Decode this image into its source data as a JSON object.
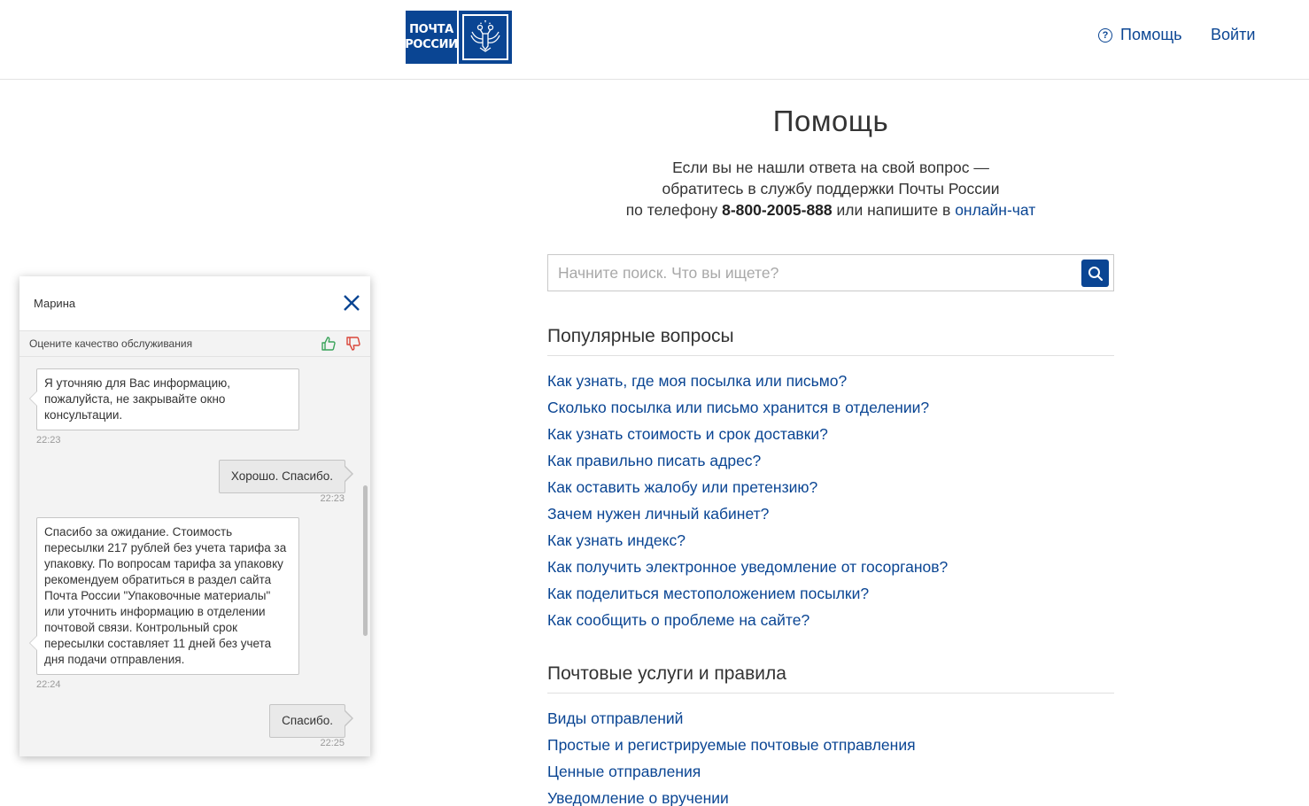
{
  "header": {
    "logo_line1": "ПОЧТА",
    "logo_line2": "РОССИИ",
    "help_label": "Помощь",
    "login_label": "Войти",
    "brand_color": "#0a4593"
  },
  "main": {
    "title": "Помощь",
    "intro_line1": "Если вы не нашли ответа на свой вопрос —",
    "intro_line2": "обратитесь в службу поддержки Почты России",
    "intro_line3_prefix": "по телефону ",
    "phone": "8-800-2005-888",
    "intro_line3_middle": " или напишите в ",
    "chat_link": "онлайн-чат",
    "search_placeholder": "Начните поиск. Что вы ищете?"
  },
  "sections": [
    {
      "title": "Популярные вопросы",
      "links": [
        "Как узнать, где моя посылка или письмо?",
        "Сколько посылка или письмо хранится в отделении?",
        "Как узнать стоимость и срок доставки?",
        "Как правильно писать адрес?",
        "Как оставить жалобу или претензию?",
        "Зачем нужен личный кабинет?",
        "Как узнать индекс?",
        "Как получить электронное уведомление от госорганов?",
        "Как поделиться местоположением посылки?",
        "Как сообщить о проблеме на сайте?"
      ]
    },
    {
      "title": "Почтовые услуги и правила",
      "links": [
        "Виды отправлений",
        "Простые и регистрируемые почтовые отправления",
        "Ценные отправления",
        "Уведомление о вручении"
      ]
    }
  ],
  "chat": {
    "agent_name": "Марина",
    "rate_label": "Оцените качество обслуживания",
    "messages": [
      {
        "from": "agent",
        "text": "Я уточняю для Вас информацию, пожалуйста, не закрывайте окно консультации.",
        "time": "22:23"
      },
      {
        "from": "user",
        "text": "Хорошо. Спасибо.",
        "time": "22:23"
      },
      {
        "from": "agent",
        "text": "Спасибо за ожидание. Стоимость пересылки 217 рублей без учета тарифа за упаковку. По вопросам тарифа за упаковку рекомендуем обратиться в раздел сайта Почта России \"Упаковочные материалы\" или уточнить информацию в отделении почтовой связи. Контрольный срок пересылки составляет 11 дней без учета дня подачи отправления.",
        "time": "22:24"
      },
      {
        "from": "user",
        "text": "Спасибо.",
        "time": "22:25"
      }
    ],
    "thumb_up_color": "#3aa35a",
    "thumb_down_color": "#d9463a"
  }
}
